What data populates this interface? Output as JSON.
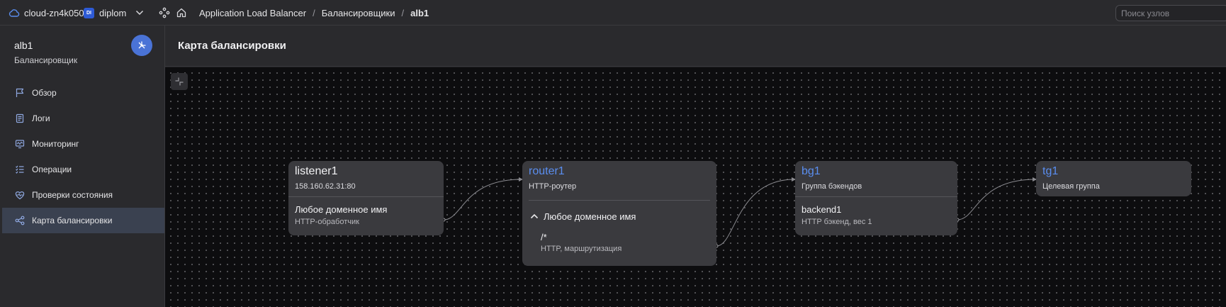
{
  "topbar": {
    "cloud_name": "cloud-zn4k050",
    "folder_badge": "DI",
    "folder_name": "diplom",
    "breadcrumbs": [
      "Application Load Balancer",
      "Балансировщики",
      "alb1"
    ],
    "search_placeholder": "Поиск узлов"
  },
  "sidebar": {
    "title": "alb1",
    "subtitle": "Балансировщик",
    "items": [
      {
        "label": "Обзор",
        "icon": "flag-icon"
      },
      {
        "label": "Логи",
        "icon": "logs-icon"
      },
      {
        "label": "Мониторинг",
        "icon": "monitoring-icon"
      },
      {
        "label": "Операции",
        "icon": "operations-icon"
      },
      {
        "label": "Проверки состояния",
        "icon": "health-check-icon"
      },
      {
        "label": "Карта балансировки",
        "icon": "balancing-map-icon",
        "active": true
      }
    ]
  },
  "main": {
    "title": "Карта балансировки"
  },
  "map": {
    "listener": {
      "name": "listener1",
      "address": "158.160.62.31:80",
      "handler_title": "Любое доменное имя",
      "handler_sub": "HTTP-обработчик"
    },
    "router": {
      "name": "router1",
      "type": "HTTP-роутер",
      "virtual_host": "Любое доменное имя",
      "route_path": "/*",
      "route_sub": "HTTP, маршрутизация"
    },
    "backend_group": {
      "name": "bg1",
      "type": "Группа бэкендов",
      "backend_name": "backend1",
      "backend_sub": "HTTP бэкенд, вес 1"
    },
    "target_group": {
      "name": "tg1",
      "type": "Целевая группа"
    }
  },
  "colors": {
    "accent": "#4a73d6",
    "link": "#5a8ef0",
    "active_nav": "#3a4150",
    "canvas": "#0d0d0f",
    "card": "#3a3a3e"
  }
}
